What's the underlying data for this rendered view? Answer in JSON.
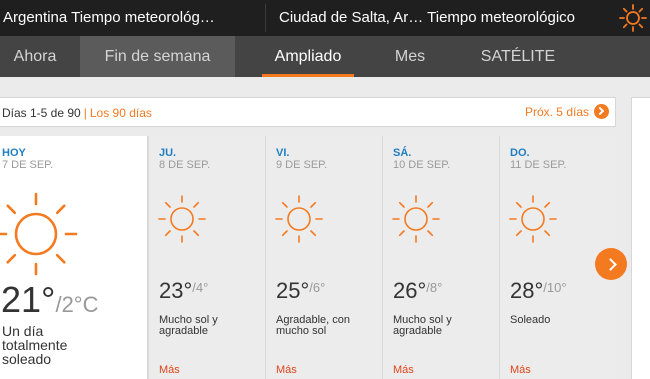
{
  "header": {
    "left_title": "Argentina Tiempo meteorológ…",
    "city_title": "Ciudad de Salta, Ar… Tiempo meteorológico",
    "icon": "sun-icon"
  },
  "nav": {
    "tabs": [
      {
        "label": "Ahora"
      },
      {
        "label": "Fin de semana"
      },
      {
        "label": "Ampliado"
      },
      {
        "label": "Mes"
      },
      {
        "label": "SATÉLITE"
      }
    ],
    "active": "Ampliado"
  },
  "range_bar": {
    "count": "Días 1-5 de 90",
    "separator": "|",
    "link": "Los 90 días",
    "next_label": "Próx. 5 días"
  },
  "days": [
    {
      "day": "HOY",
      "date": "7 DE SEP.",
      "high": "21°",
      "low": "/2°C",
      "desc_lines": [
        "Un día",
        "totalmente",
        "soleado"
      ],
      "more": "",
      "icon": "sun-icon"
    },
    {
      "day": "JU.",
      "date": "8 DE SEP.",
      "high": "23°",
      "low": "/4°",
      "desc_lines": [
        "Mucho sol y",
        "agradable"
      ],
      "more": "Más",
      "icon": "sun-icon"
    },
    {
      "day": "VI.",
      "date": "9 DE SEP.",
      "high": "25°",
      "low": "/6°",
      "desc_lines": [
        "Agradable, con",
        "mucho sol"
      ],
      "more": "Más",
      "icon": "sun-icon"
    },
    {
      "day": "SÁ.",
      "date": "10 DE SEP.",
      "high": "26°",
      "low": "/8°",
      "desc_lines": [
        "Mucho sol y",
        "agradable"
      ],
      "more": "Más",
      "icon": "sun-icon"
    },
    {
      "day": "DO.",
      "date": "11 DE SEP.",
      "high": "28°",
      "low": "/10°",
      "desc_lines": [
        "Soleado"
      ],
      "more": "Más",
      "icon": "sun-icon"
    }
  ],
  "colors": {
    "accent": "#f47a20",
    "day_label": "#1f7fc1",
    "more_link": "#e0451a",
    "header_bg": "#1f1f1f",
    "nav_bg": "#444444"
  }
}
